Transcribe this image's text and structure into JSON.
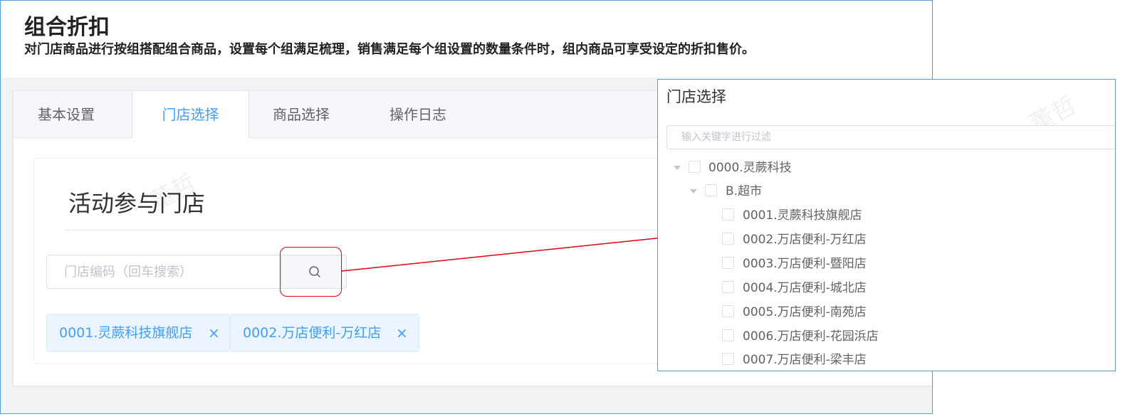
{
  "page": {
    "title": "组合折扣",
    "description": "对门店商品进行按组搭配组合商品，设置每个组满足梳理，销售满足每个组设置的数量条件时，组内商品可享受设定的折扣售价。"
  },
  "tabs": [
    {
      "label": "基本设置",
      "active": false
    },
    {
      "label": "门店选择",
      "active": true
    },
    {
      "label": "商品选择",
      "active": false
    },
    {
      "label": "操作日志",
      "active": false
    }
  ],
  "section": {
    "title": "活动参与门店"
  },
  "search": {
    "placeholder": "门店编码（回车搜索）"
  },
  "selected_tags": [
    {
      "label": "0001.灵蕨科技旗舰店",
      "close": "×"
    },
    {
      "label": "0002.万店便利-万红店",
      "close": "×"
    }
  ],
  "watermark": "董哲",
  "popup": {
    "title": "门店选择",
    "filter_placeholder": "输入关键字进行过滤",
    "tree": {
      "root": "0000.灵蕨科技",
      "group": "B.超市",
      "stores": [
        "0001.灵蕨科技旗舰店",
        "0002.万店便利-万红店",
        "0003.万店便利-暨阳店",
        "0004.万店便利-城北店",
        "0005.万店便利-南苑店",
        "0006.万店便利-花园浜店",
        "0007.万店便利-梁丰店"
      ]
    }
  },
  "colors": {
    "accent": "#409eff",
    "annotation": "#e60012",
    "frame": "#5b9bd5"
  }
}
